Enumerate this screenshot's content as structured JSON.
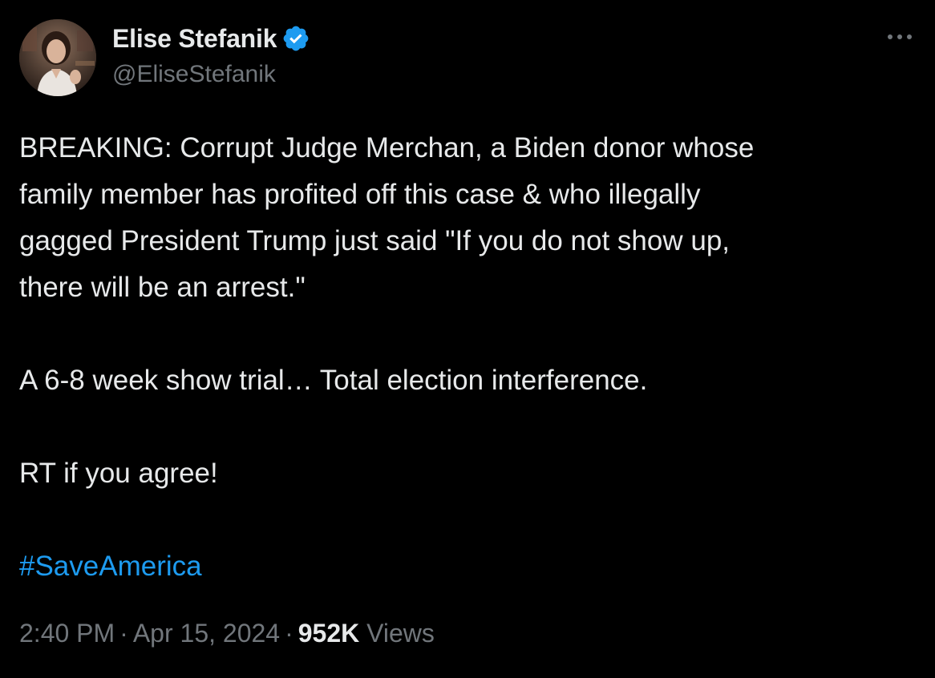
{
  "author": {
    "display_name": "Elise Stefanik",
    "handle": "@EliseStefanik",
    "verified": true
  },
  "tweet": {
    "lines": [
      "BREAKING: Corrupt Judge Merchan, a Biden donor whose",
      "family member has profited off this case & who illegally",
      "gagged President Trump just said \"If you do not show up,",
      "there will be an arrest.\""
    ],
    "paragraph_2": "A 6-8 week show trial… Total election interference.",
    "paragraph_3": "RT if you agree!",
    "hashtag": "#SaveAmerica"
  },
  "meta": {
    "time": "2:40 PM",
    "separator": "·",
    "date": "Apr 15, 2024",
    "views_count": "952K",
    "views_label": "Views"
  },
  "icons": {
    "verified": "verified-badge-icon",
    "more": "more-options-icon"
  },
  "colors": {
    "background": "#000000",
    "text": "#e7e9ea",
    "secondary": "#71767b",
    "accent": "#1d9bf0"
  }
}
